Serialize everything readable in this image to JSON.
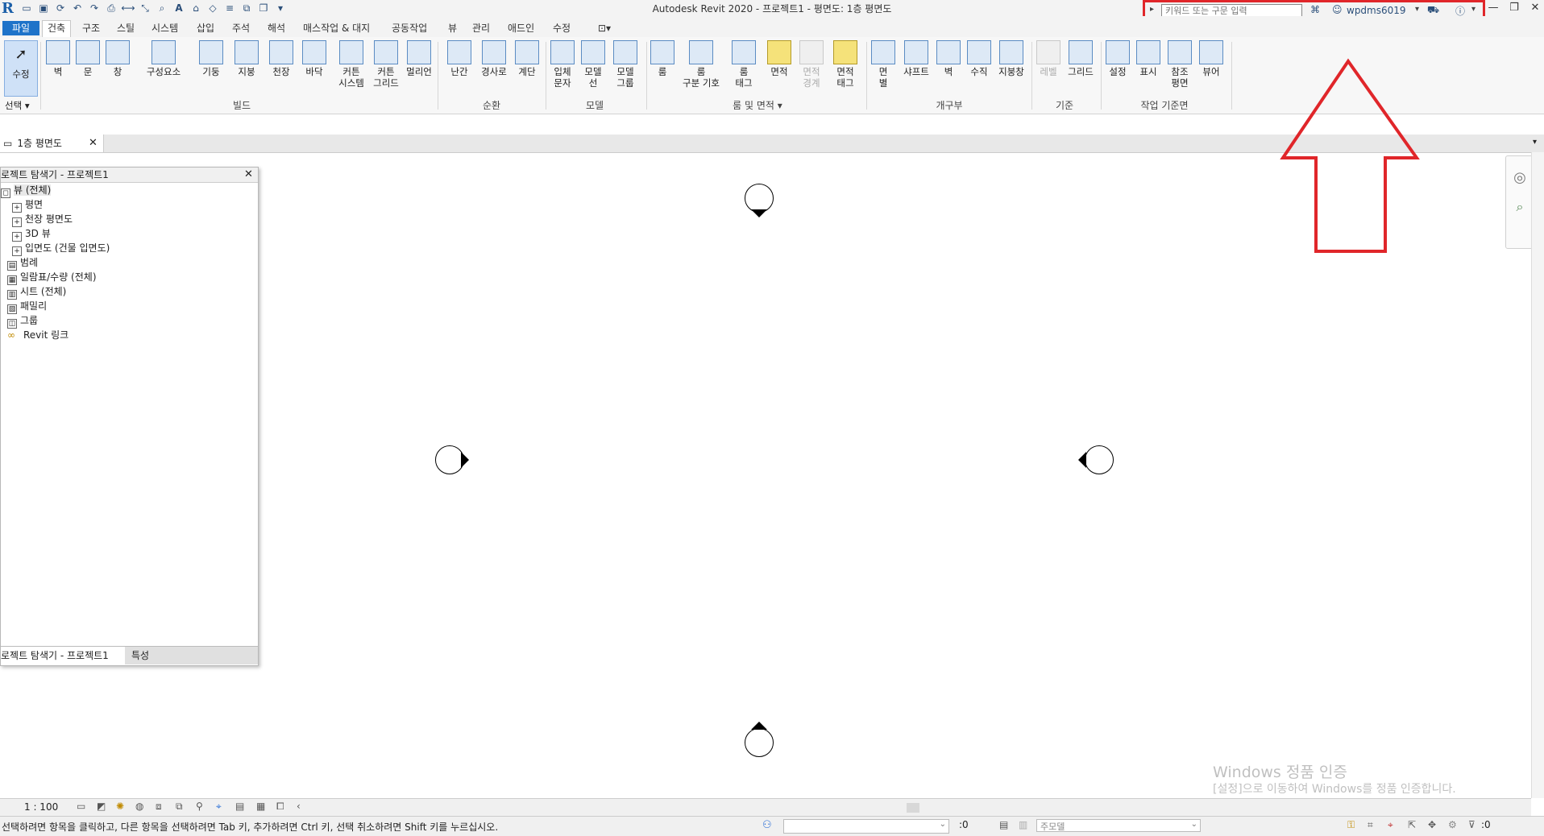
{
  "window": {
    "title": "Autodesk Revit 2020 - 프로젝트1 - 평면도: 1층 평면도",
    "search_placeholder": "키워드 또는 구문 입력",
    "user": "wpdms6019",
    "controls": [
      "—",
      "❐",
      "✕"
    ]
  },
  "ribbon": {
    "tabs": [
      "파일",
      "건축",
      "구조",
      "스틸",
      "시스템",
      "삽입",
      "주석",
      "해석",
      "매스작업 & 대지",
      "공동작업",
      "뷰",
      "관리",
      "애드인",
      "수정"
    ],
    "active_tab": "건축",
    "select_label": "선택",
    "modify_label": "수정",
    "tools": [
      {
        "label": "벽"
      },
      {
        "label": "문"
      },
      {
        "label": "창"
      },
      {
        "label": "구성요소"
      },
      {
        "label": "기둥"
      },
      {
        "label": "지붕"
      },
      {
        "label": "천장"
      },
      {
        "label": "바닥"
      },
      {
        "label": "커튼\n시스템"
      },
      {
        "label": "커튼\n그리드"
      },
      {
        "label": "멀리언"
      },
      {
        "label": "난간"
      },
      {
        "label": "경사로"
      },
      {
        "label": "계단"
      },
      {
        "label": "입체\n문자"
      },
      {
        "label": "모델\n선"
      },
      {
        "label": "모델\n그룹"
      },
      {
        "label": "룸"
      },
      {
        "label": "룸\n구분 기호"
      },
      {
        "label": "룸\n태그"
      },
      {
        "label": "면적"
      },
      {
        "label": "면적\n경계"
      },
      {
        "label": "면적\n태그"
      },
      {
        "label": "면\n별"
      },
      {
        "label": "샤프트"
      },
      {
        "label": "벽"
      },
      {
        "label": "수직"
      },
      {
        "label": "지붕창"
      },
      {
        "label": "레벨"
      },
      {
        "label": "그리드"
      },
      {
        "label": "설정"
      },
      {
        "label": "표시"
      },
      {
        "label": "참조\n평면"
      },
      {
        "label": "뷰어"
      }
    ],
    "panels": [
      "빌드",
      "순환",
      "모델",
      "룸 및 면적",
      "개구부",
      "기준",
      "작업 기준면"
    ]
  },
  "view_tab": {
    "label": "1층 평면도"
  },
  "browser": {
    "title": "로젝트 탐색기 - 프로젝트1",
    "items": [
      {
        "label": "뷰 (전체)"
      },
      {
        "label": "평면"
      },
      {
        "label": "천장 평면도"
      },
      {
        "label": "3D 뷰"
      },
      {
        "label": "입면도 (건물 입면도)"
      },
      {
        "label": "범례"
      },
      {
        "label": "일람표/수량 (전체)"
      },
      {
        "label": "시트 (전체)"
      },
      {
        "label": "패밀리"
      },
      {
        "label": "그룹"
      },
      {
        "label": "Revit 링크"
      }
    ],
    "bottom_tabs": [
      "로젝트 탐색기 - 프로젝트1",
      "특성"
    ]
  },
  "view_control": {
    "scale": "1 : 100"
  },
  "status": {
    "message": "선택하려면 항목을 클릭하고, 다른 항목을 선택하려면 Tab 키, 추가하려면 Ctrl 키, 선택 취소하려면 Shift 키를 누르십시오.",
    "workset": ":0",
    "model": "주모델",
    "filter": ":0"
  },
  "watermark": {
    "line1": "Windows 정품 인증",
    "line2": "[설정]으로 이동하여 Windows를 정품 인증합니다."
  },
  "colors": {
    "annotation": "#e0262a",
    "file_tab": "#1e73c9"
  }
}
